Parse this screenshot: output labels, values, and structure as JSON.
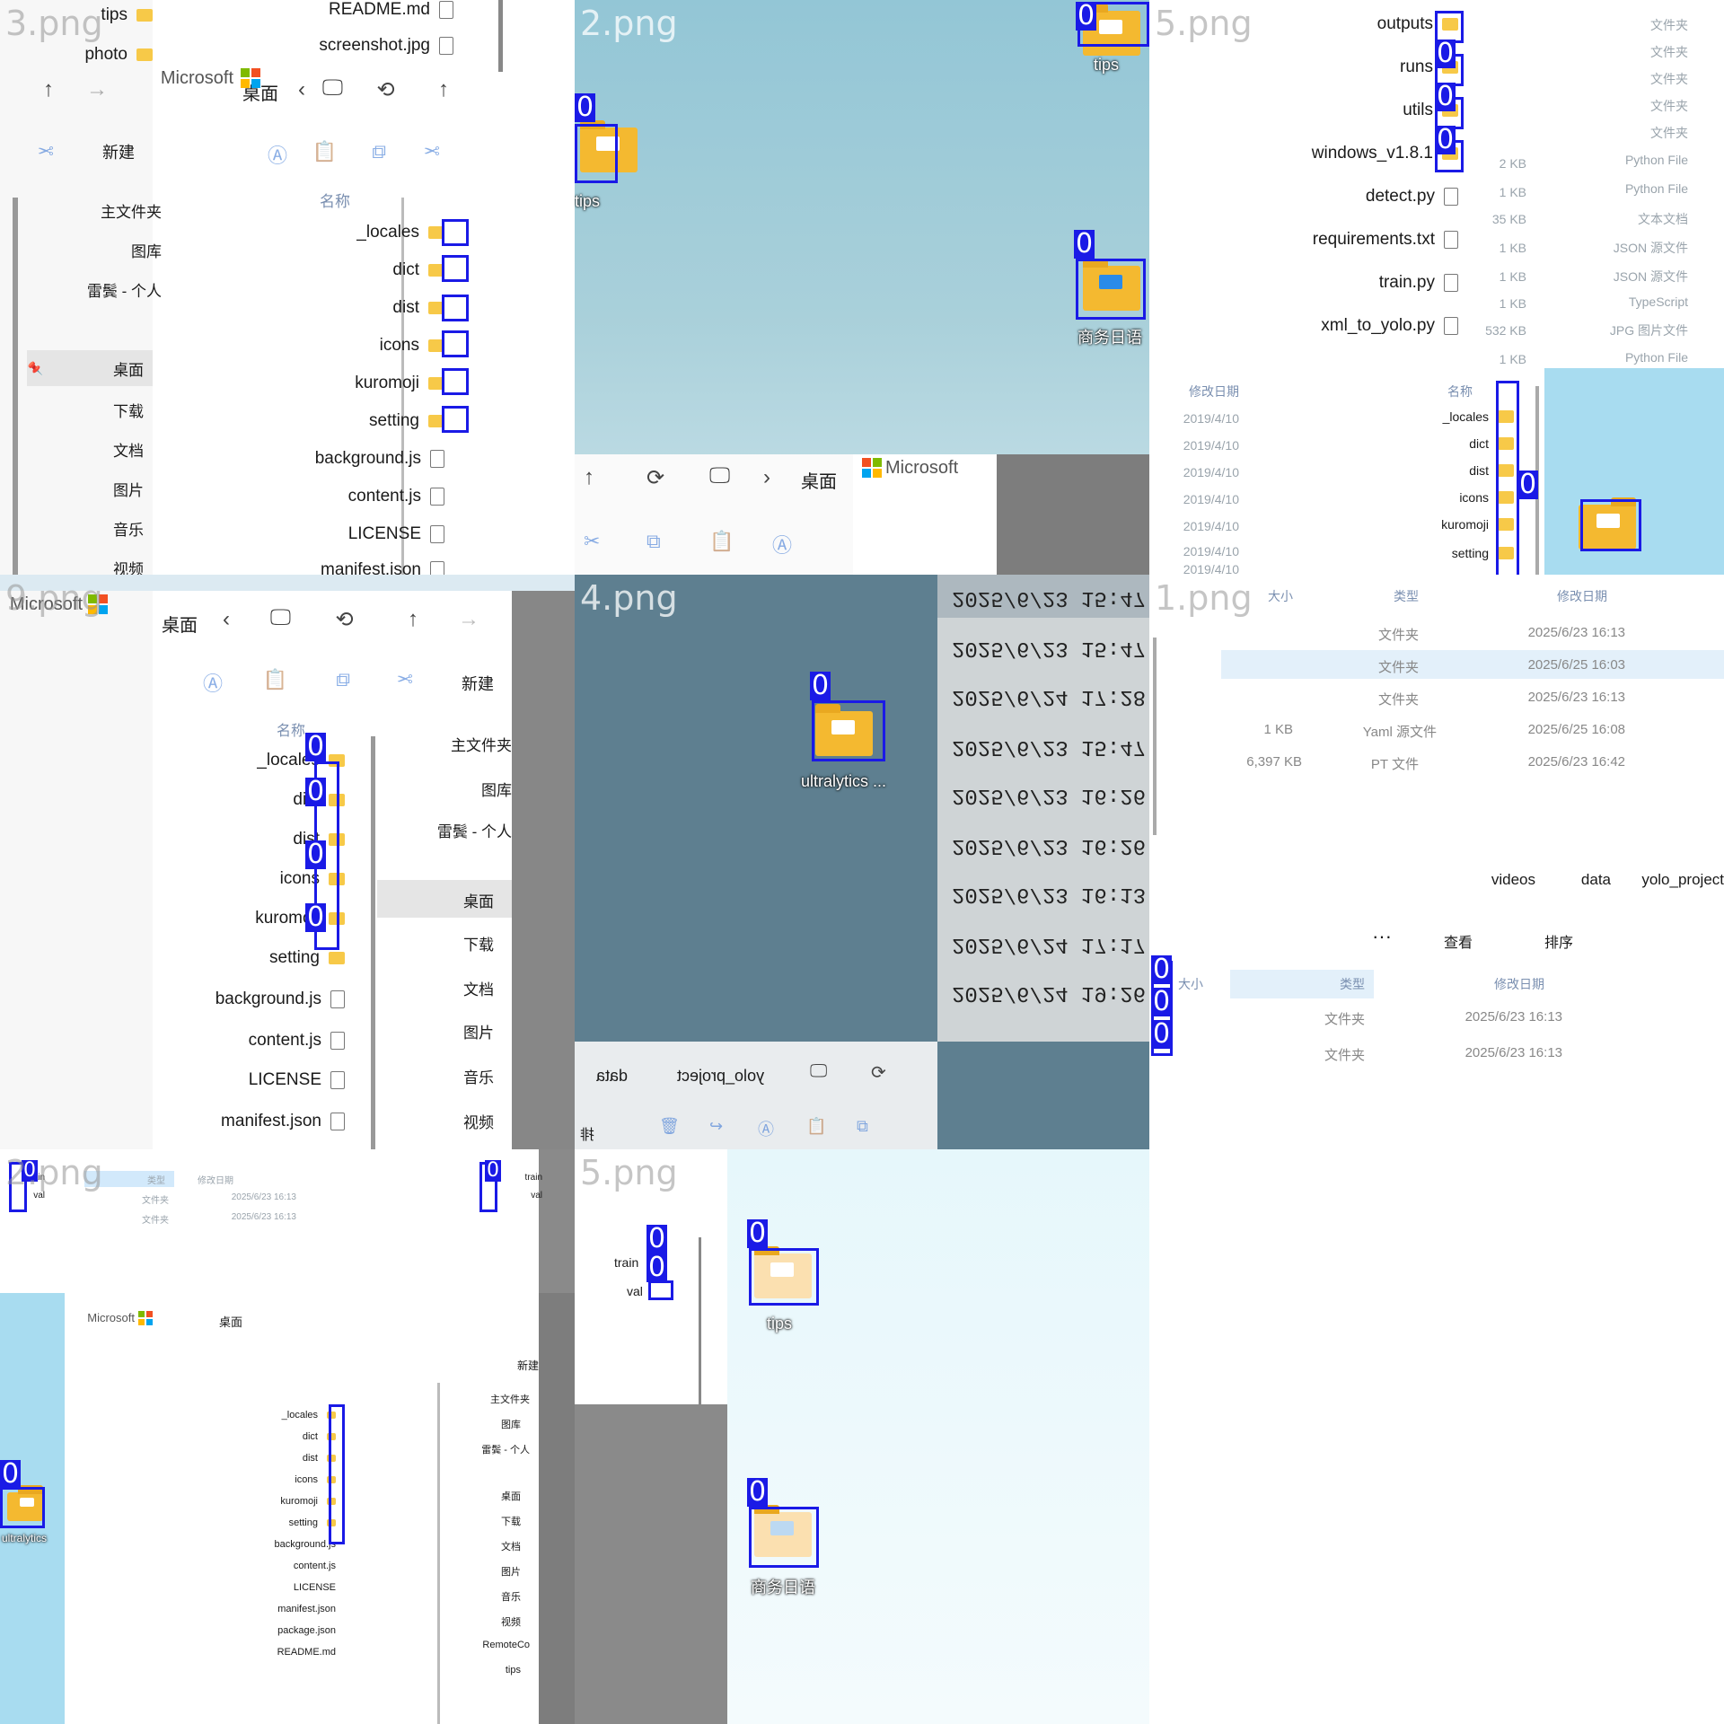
{
  "colors": {
    "detection": "#1a1ae6",
    "folder": "#f4b930",
    "sky": "#a9d0da"
  },
  "tiles": [
    {
      "label": "3.png",
      "mirrored": true
    },
    {
      "label": "2.png",
      "mirrored": false
    },
    {
      "label": "5.png",
      "mirrored": true
    },
    {
      "label": "9.png",
      "mirrored": true
    },
    {
      "label": "4.png",
      "mirrored": false
    },
    {
      "label": "1.png",
      "mirrored": true
    },
    {
      "label": "2.png",
      "mirrored": true
    },
    {
      "label": "5.png",
      "mirrored": false
    }
  ],
  "detection_label": "0",
  "explorer": {
    "breadcrumb_desktop": "桌面",
    "new_label": "新建",
    "ms_brand": "Microsoft",
    "sidebar": [
      "主文件夹",
      "图库",
      "雷鬓 - 个人"
    ],
    "pinned": [
      "桌面",
      "下载",
      "文档",
      "图片",
      "音乐",
      "视频"
    ],
    "name_header": "名称",
    "folders": [
      "_locales",
      "dict",
      "dist",
      "icons",
      "kuromoji",
      "setting"
    ],
    "files": [
      "background.js",
      "content.js",
      "LICENSE",
      "manifest.json",
      "package.json",
      "README.md"
    ],
    "extra_folder": "RemoteCo",
    "top_files": [
      "README.md",
      "screenshot.jpg"
    ],
    "top_items": [
      "tips",
      "photo"
    ]
  },
  "desktop": {
    "tips": "tips",
    "tips_short": "tips",
    "business_diary": "商务日语",
    "ultralytics": "ultralytics",
    "ultralytics_trunc": "ultralytics ..."
  },
  "project5": {
    "folders": [
      "outputs",
      "runs",
      "utils",
      "windows_v1.8.1"
    ],
    "files": [
      "detect.py",
      "requirements.txt",
      "train.py",
      "xml_to_yolo.py"
    ],
    "types_faint": [
      "文件夹",
      "文件夹",
      "文件夹",
      "文件夹",
      "文件夹",
      "Python File",
      "Python File",
      "文本文档",
      "JSON 源文件",
      "JSON 源文件",
      "TypeScript",
      "JPG 图片文件",
      "Python File"
    ],
    "sizes_faint": [
      "2 KB",
      "1 KB",
      "35 KB",
      "1 KB",
      "1 KB",
      "1 KB",
      "532 KB",
      "1 KB"
    ],
    "dates_faint": [
      "2019/4/10",
      "2019/4/10",
      "2019/4/10",
      "2019/4/10",
      "2019/4/10",
      "2019/4/10",
      "2019/4/10"
    ],
    "date_header": "修改日期"
  },
  "tile4": {
    "dates": [
      "2025/6/23 15:47",
      "2025/6/23 15:47",
      "2025/6/24 17:28",
      "2025/6/23 15:47",
      "2025/6/23 16:26",
      "2025/6/23 16:26",
      "2025/6/23 16:13",
      "2025/6/24 17:17",
      "2025/6/24 19:26"
    ],
    "breadcrumb": [
      "yolo_project",
      "data"
    ],
    "sort_label": "排"
  },
  "tile1": {
    "headers": [
      "修改日期",
      "类型",
      "大小"
    ],
    "rows": [
      {
        "date": "2025/6/23 16:13",
        "type": "文件夹",
        "size": ""
      },
      {
        "date": "2025/6/25 16:03",
        "type": "文件夹",
        "size": ""
      },
      {
        "date": "2025/6/23 16:13",
        "type": "文件夹",
        "size": ""
      },
      {
        "date": "2025/6/25 16:08",
        "type": "Yaml 源文件",
        "size": "1 KB"
      },
      {
        "date": "2025/6/23 16:42",
        "type": "PT 文件",
        "size": "6,397 KB"
      }
    ],
    "breadcrumb": [
      "yolo_project",
      "data",
      "videos"
    ],
    "sort": "排序",
    "view": "查看",
    "more": "···",
    "lower_rows": [
      {
        "date": "2025/6/23 16:13",
        "type": "文件夹"
      },
      {
        "date": "2025/6/23 16:13",
        "type": "文件夹"
      }
    ]
  },
  "tile7": {
    "items": [
      "train",
      "val"
    ]
  },
  "tile8": {
    "items": [
      "train",
      "val"
    ]
  }
}
